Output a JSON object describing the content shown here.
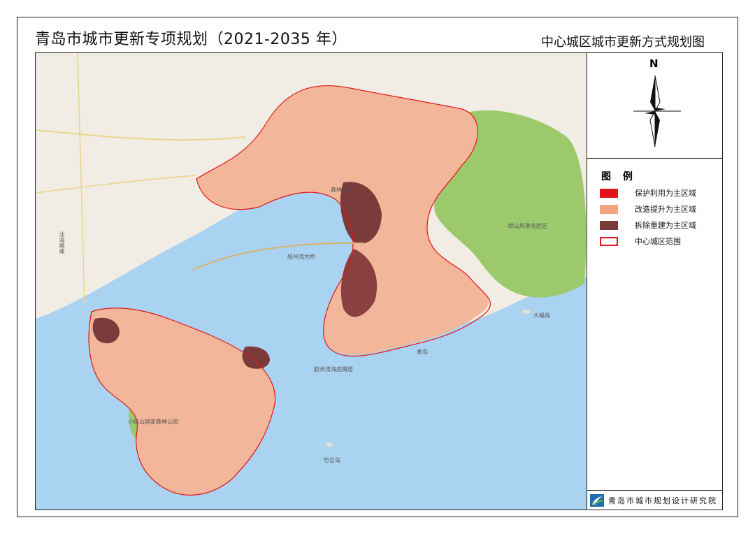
{
  "header": {
    "title": "青岛市城市更新专项规划（2021-2035 年）",
    "subtitle": "中心城区城市更新方式规划图"
  },
  "compass": {
    "label": "N"
  },
  "legend": {
    "title": "图 例",
    "items": [
      {
        "label": "保护利用为主区域",
        "color": "#e3151b",
        "style": "fill"
      },
      {
        "label": "改造提升为主区域",
        "color": "#f2a57e",
        "style": "fill"
      },
      {
        "label": "拆除重建为主区域",
        "color": "#7b3b3b",
        "style": "fill"
      },
      {
        "label": "中心城区范围",
        "color": "#e3151b",
        "style": "outline"
      }
    ]
  },
  "footer": {
    "org": "青岛市城市规划设计研究院"
  },
  "map_labels": {
    "bridge": "胶州湾大桥",
    "tunnel": "胶州湾海底隧道",
    "laoshan": "崂山风景名胜区",
    "dafu": "大福岛",
    "maidao": "麦岛",
    "zhuchadao": "竹岔岛",
    "xiaozhushan": "小珠山国家森林公园",
    "expressway": "沈海高速",
    "park": "森林公园"
  }
}
